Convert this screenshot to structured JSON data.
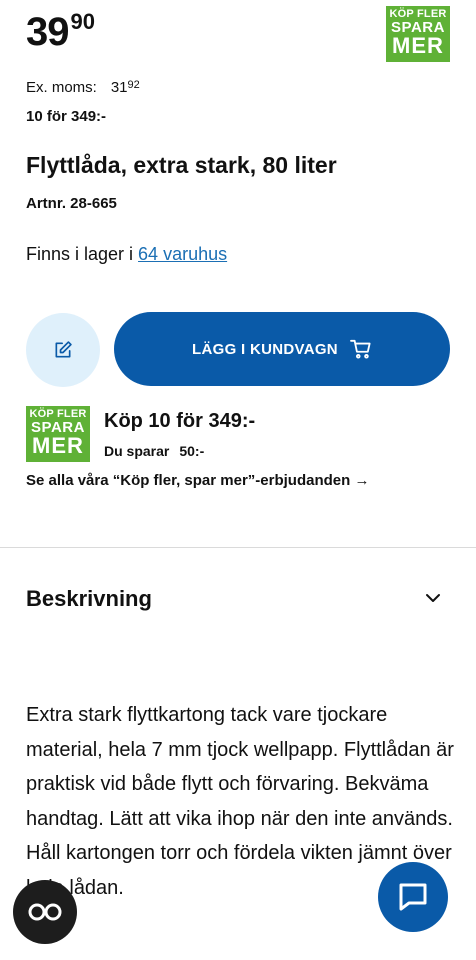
{
  "price": {
    "integer": "39",
    "decimal": "90"
  },
  "badge": {
    "line1": "KÖP FLER",
    "line2": "SPARA",
    "line3": "MER",
    "color": "#5fb136"
  },
  "ex_moms": {
    "label": "Ex. moms:",
    "integer": "31",
    "decimal": "92"
  },
  "multi_offer": "10 för 349:-",
  "product": {
    "title": "Flyttlåda, extra stark, 80 liter",
    "artnr": "Artnr. 28-665"
  },
  "stock": {
    "prefix": "Finns i lager i ",
    "link": "64 varuhus"
  },
  "buttons": {
    "add_to_cart": "LÄGG I KUNDVAGN",
    "accent": "#0a5aa8"
  },
  "promo": {
    "title": "Köp 10 för 349:-",
    "save_label": "Du sparar",
    "save_amount": "50:-",
    "link": "Se alla våra “Köp fler, spar mer”-erbjudanden →"
  },
  "description": {
    "heading": "Beskrivning",
    "text": "Extra stark flyttkartong tack vare tjockare material, hela 7 mm tjock wellpapp. Flyttlådan är praktisk vid både flytt och förvaring. Bekväma handtag. Lätt att vika ihop när den inte används. Håll kartongen torr och fördela vikten jämnt över hela lådan."
  },
  "icons": {
    "note": "edit-note-icon",
    "cart": "shopping-cart-icon",
    "chevron": "chevron-down-icon",
    "chat_left": "co-chat-icon",
    "chat_right": "chat-bubble-icon"
  }
}
